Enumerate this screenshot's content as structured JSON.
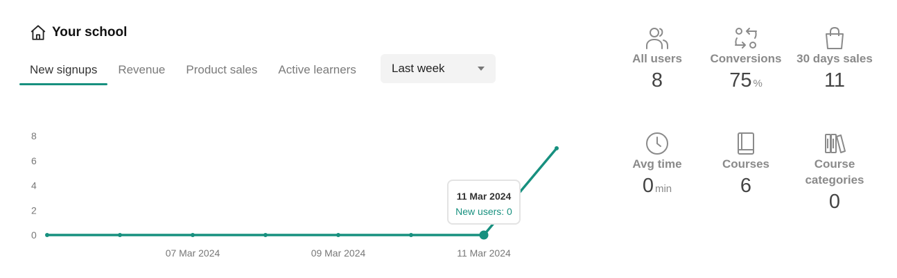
{
  "header": {
    "title": "Your school",
    "icon": "home-icon"
  },
  "tabs": [
    {
      "label": "New signups",
      "active": true
    },
    {
      "label": "Revenue",
      "active": false
    },
    {
      "label": "Product sales",
      "active": false
    },
    {
      "label": "Active learners",
      "active": false
    }
  ],
  "period_select": {
    "value": "Last week"
  },
  "chart_data": {
    "type": "line",
    "x": [
      "05 Mar 2024",
      "06 Mar 2024",
      "07 Mar 2024",
      "08 Mar 2024",
      "09 Mar 2024",
      "10 Mar 2024",
      "11 Mar 2024",
      "12 Mar 2024"
    ],
    "x_tick_labels": [
      "07 Mar 2024",
      "09 Mar 2024",
      "11 Mar 2024"
    ],
    "y_ticks": [
      "0",
      "2",
      "4",
      "6",
      "8"
    ],
    "ylim": [
      0,
      8
    ],
    "series": [
      {
        "values": [
          0,
          0,
          0,
          0,
          0,
          0,
          0,
          7
        ]
      }
    ],
    "color": "#17907f",
    "highlighted_index": 6
  },
  "tooltip": {
    "date": "11 Mar 2024",
    "text": "New users: 0"
  },
  "stats": {
    "all_users": {
      "label": "All users",
      "value": "8",
      "icon": "users-icon"
    },
    "conversions": {
      "label": "Conversions",
      "value": "75",
      "unit": "%",
      "icon": "conversions-icon"
    },
    "sales_30d": {
      "label": "30 days sales",
      "value": "11",
      "icon": "shopping-bag-icon"
    },
    "avg_time": {
      "label": "Avg time",
      "value": "0",
      "unit": "min",
      "icon": "clock-icon"
    },
    "courses": {
      "label": "Courses",
      "value": "6",
      "icon": "book-icon"
    },
    "categories": {
      "label_line1": "Course",
      "label_line2": "categories",
      "value": "0",
      "icon": "library-icon"
    }
  }
}
